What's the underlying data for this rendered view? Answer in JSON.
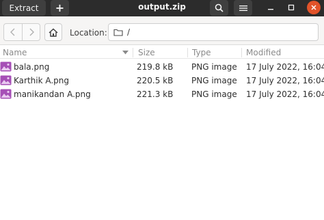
{
  "window": {
    "title": "output.zip",
    "extract_label": "Extract",
    "add_label": "+"
  },
  "location": {
    "label": "Location:",
    "path": "/"
  },
  "columns": {
    "name": "Name",
    "size": "Size",
    "type": "Type",
    "modified": "Modified"
  },
  "files": [
    {
      "name": "bala.png",
      "size": "219.8 kB",
      "type": "PNG image",
      "modified": "17 July 2022, 16:04"
    },
    {
      "name": "Karthik A.png",
      "size": "220.5 kB",
      "type": "PNG image",
      "modified": "17 July 2022, 16:04"
    },
    {
      "name": "manikandan A.png",
      "size": "221.3 kB",
      "type": "PNG image",
      "modified": "17 July 2022, 16:04"
    }
  ],
  "icons": {
    "search": "search-icon",
    "menu": "hamburger-menu-icon",
    "minimize": "minimize-icon",
    "maximize": "maximize-icon",
    "close": "close-icon",
    "back": "chevron-left-icon",
    "forward": "chevron-right-icon",
    "home": "home-icon",
    "folder": "folder-icon",
    "image_file": "image-file-icon",
    "sort": "sort-down-arrow-icon"
  },
  "colors": {
    "headerbar": "#2c2c2c",
    "close_button": "#e2532a",
    "image_icon": "#a64fb6"
  }
}
